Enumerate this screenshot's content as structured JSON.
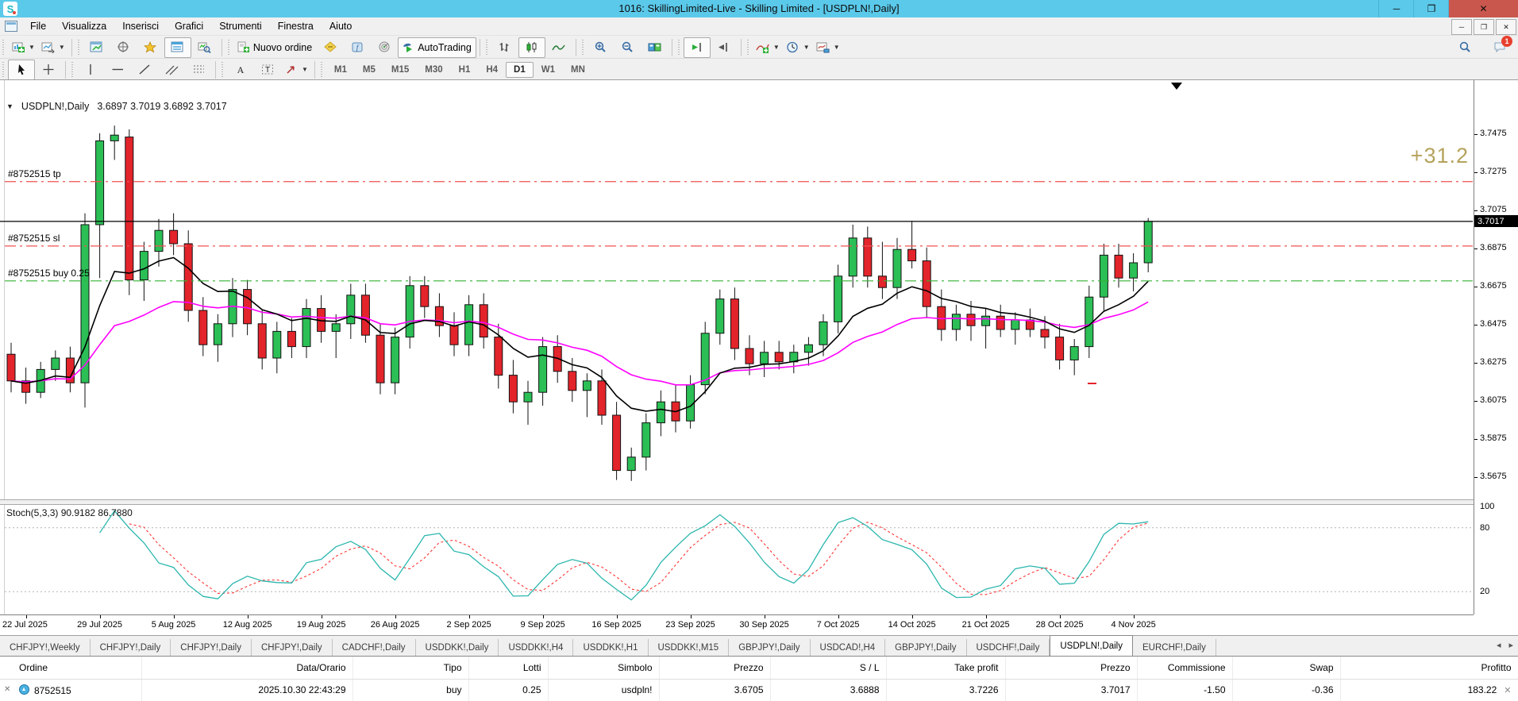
{
  "window": {
    "title": "1016: SkillingLimited-Live - Skilling Limited - [USDPLN!,Daily]",
    "controls": {
      "minimize": "─",
      "restore": "❐",
      "close": "✕"
    }
  },
  "menu": {
    "items": [
      "File",
      "Visualizza",
      "Inserisci",
      "Grafici",
      "Strumenti",
      "Finestra",
      "Aiuto"
    ]
  },
  "toolbar_main": {
    "groups": [
      [
        {
          "icon": "new-chart",
          "dd": true
        },
        {
          "icon": "profiles",
          "dd": true
        }
      ],
      [
        {
          "icon": "market-watch"
        },
        {
          "icon": "data-window"
        },
        {
          "icon": "navigator"
        },
        {
          "icon": "terminal",
          "sel": true
        },
        {
          "icon": "tester"
        }
      ],
      [
        {
          "icon": "new-order",
          "label": "Nuovo ordine"
        },
        {
          "icon": "metaeditor"
        },
        {
          "icon": "experts"
        },
        {
          "icon": "radar"
        },
        {
          "icon": "autotrading",
          "label": "AutoTrading",
          "sel": true
        }
      ],
      [
        {
          "icon": "bars"
        },
        {
          "icon": "candles",
          "sel": true
        },
        {
          "icon": "linechart"
        }
      ],
      [
        {
          "icon": "zoom-in"
        },
        {
          "icon": "zoom-out"
        },
        {
          "icon": "tiles"
        }
      ],
      [
        {
          "icon": "autoscroll",
          "sel": true
        },
        {
          "icon": "shift"
        }
      ],
      [
        {
          "icon": "indicators",
          "dd": true
        },
        {
          "icon": "periods",
          "dd": true
        },
        {
          "icon": "templates",
          "dd": true
        }
      ]
    ],
    "right": [
      {
        "icon": "search"
      },
      {
        "icon": "chat",
        "badge": "1"
      }
    ]
  },
  "toolbar_draw": {
    "groups": [
      [
        {
          "icon": "cursor",
          "sel": true
        },
        {
          "icon": "crosshair"
        }
      ],
      [
        {
          "icon": "vline"
        },
        {
          "icon": "hline"
        },
        {
          "icon": "trendline"
        },
        {
          "icon": "channel"
        },
        {
          "icon": "fibonacci"
        }
      ],
      [
        {
          "icon": "text"
        },
        {
          "icon": "label"
        },
        {
          "icon": "arrows",
          "dd": true
        }
      ]
    ]
  },
  "timeframes": {
    "items": [
      "M1",
      "M5",
      "M15",
      "M30",
      "H1",
      "H4",
      "D1",
      "W1",
      "MN"
    ],
    "active": "D1"
  },
  "chart": {
    "symbol_label": "USDPLN!,Daily",
    "ohlc_string": "3.6897 3.7019 3.6892 3.7017",
    "profit_label": "+31.2",
    "stoch_label": "Stoch(5,3,3) 90.9182 86.7880",
    "order_labels": {
      "tp": "#8752515 tp",
      "sl": "#8752515 sl",
      "buy": "#8752515 buy 0.25"
    }
  },
  "chart_data": {
    "type": "candlestick",
    "title": "USDPLN! Daily",
    "bid": 3.7017,
    "bid_display": "3.7017",
    "order": {
      "ticket": "#8752515",
      "take_profit": 3.7226,
      "stop_loss": 3.6888,
      "open_price": 3.6705,
      "lots": "0.25"
    },
    "price_axis_ticks": [
      "3.7475",
      "3.7275",
      "3.7075",
      "3.6875",
      "3.6675",
      "3.6475",
      "3.6275",
      "3.6075",
      "3.5875",
      "3.5675"
    ],
    "date_ticks": [
      "22 Jul 2025",
      "29 Jul 2025",
      "5 Aug 2025",
      "12 Aug 2025",
      "19 Aug 2025",
      "26 Aug 2025",
      "2 Sep 2025",
      "9 Sep 2025",
      "16 Sep 2025",
      "23 Sep 2025",
      "30 Sep 2025",
      "7 Oct 2025",
      "14 Oct 2025",
      "21 Oct 2025",
      "28 Oct 2025",
      "4 Nov 2025"
    ],
    "stochastic": {
      "label": "Stoch(5,3,3)",
      "k": "90.9182",
      "d": "86.7880",
      "levels": [
        80,
        20
      ],
      "scale_labels": [
        "100",
        "80",
        "20"
      ]
    },
    "ma_fast_period": 9,
    "ma_slow_period": 21,
    "candles": [
      [
        3.632,
        3.638,
        3.612,
        3.618
      ],
      [
        3.618,
        3.625,
        3.606,
        3.612
      ],
      [
        3.612,
        3.628,
        3.609,
        3.624
      ],
      [
        3.624,
        3.634,
        3.618,
        3.63
      ],
      [
        3.63,
        3.636,
        3.612,
        3.617
      ],
      [
        3.617,
        3.706,
        3.604,
        3.7
      ],
      [
        3.7,
        3.748,
        3.672,
        3.744
      ],
      [
        3.744,
        3.752,
        3.734,
        3.747
      ],
      [
        3.746,
        3.75,
        3.663,
        3.671
      ],
      [
        3.671,
        3.691,
        3.66,
        3.686
      ],
      [
        3.686,
        3.703,
        3.678,
        3.697
      ],
      [
        3.697,
        3.706,
        3.684,
        3.69
      ],
      [
        3.69,
        3.697,
        3.649,
        3.655
      ],
      [
        3.655,
        3.662,
        3.631,
        3.637
      ],
      [
        3.637,
        3.653,
        3.628,
        3.648
      ],
      [
        3.648,
        3.672,
        3.641,
        3.666
      ],
      [
        3.666,
        3.671,
        3.642,
        3.648
      ],
      [
        3.648,
        3.655,
        3.624,
        3.63
      ],
      [
        3.63,
        3.649,
        3.622,
        3.644
      ],
      [
        3.644,
        3.651,
        3.63,
        3.636
      ],
      [
        3.636,
        3.661,
        3.63,
        3.656
      ],
      [
        3.656,
        3.663,
        3.638,
        3.644
      ],
      [
        3.644,
        3.653,
        3.63,
        3.648
      ],
      [
        3.648,
        3.669,
        3.64,
        3.663
      ],
      [
        3.663,
        3.669,
        3.638,
        3.642
      ],
      [
        3.642,
        3.648,
        3.611,
        3.617
      ],
      [
        3.617,
        3.646,
        3.611,
        3.641
      ],
      [
        3.641,
        3.673,
        3.635,
        3.668
      ],
      [
        3.668,
        3.673,
        3.651,
        3.657
      ],
      [
        3.657,
        3.664,
        3.641,
        3.647
      ],
      [
        3.647,
        3.654,
        3.631,
        3.637
      ],
      [
        3.637,
        3.663,
        3.631,
        3.658
      ],
      [
        3.658,
        3.664,
        3.635,
        3.641
      ],
      [
        3.641,
        3.648,
        3.614,
        3.621
      ],
      [
        3.621,
        3.629,
        3.601,
        3.607
      ],
      [
        3.607,
        3.618,
        3.595,
        3.612
      ],
      [
        3.612,
        3.641,
        3.605,
        3.636
      ],
      [
        3.636,
        3.642,
        3.617,
        3.623
      ],
      [
        3.623,
        3.63,
        3.607,
        3.613
      ],
      [
        3.613,
        3.622,
        3.599,
        3.618
      ],
      [
        3.618,
        3.624,
        3.595,
        3.6
      ],
      [
        3.6,
        3.607,
        3.566,
        3.571
      ],
      [
        3.571,
        3.583,
        3.5655,
        3.578
      ],
      [
        3.578,
        3.601,
        3.571,
        3.596
      ],
      [
        3.596,
        3.613,
        3.589,
        3.607
      ],
      [
        3.607,
        3.616,
        3.591,
        3.597
      ],
      [
        3.597,
        3.621,
        3.593,
        3.616
      ],
      [
        3.616,
        3.649,
        3.611,
        3.643
      ],
      [
        3.643,
        3.666,
        3.637,
        3.661
      ],
      [
        3.661,
        3.667,
        3.629,
        3.635
      ],
      [
        3.635,
        3.642,
        3.621,
        3.627
      ],
      [
        3.627,
        3.639,
        3.62,
        3.633
      ],
      [
        3.633,
        3.639,
        3.624,
        3.628
      ],
      [
        3.628,
        3.637,
        3.622,
        3.633
      ],
      [
        3.633,
        3.641,
        3.626,
        3.637
      ],
      [
        3.637,
        3.653,
        3.631,
        3.649
      ],
      [
        3.649,
        3.679,
        3.643,
        3.673
      ],
      [
        3.673,
        3.7,
        3.667,
        3.693
      ],
      [
        3.693,
        3.699,
        3.667,
        3.673
      ],
      [
        3.673,
        3.691,
        3.661,
        3.667
      ],
      [
        3.667,
        3.693,
        3.661,
        3.687
      ],
      [
        3.687,
        3.702,
        3.677,
        3.681
      ],
      [
        3.681,
        3.688,
        3.651,
        3.657
      ],
      [
        3.657,
        3.666,
        3.639,
        3.645
      ],
      [
        3.645,
        3.658,
        3.639,
        3.653
      ],
      [
        3.653,
        3.66,
        3.639,
        3.647
      ],
      [
        3.647,
        3.656,
        3.635,
        3.652
      ],
      [
        3.652,
        3.658,
        3.641,
        3.645
      ],
      [
        3.645,
        3.654,
        3.637,
        3.65
      ],
      [
        3.65,
        3.656,
        3.641,
        3.645
      ],
      [
        3.645,
        3.652,
        3.635,
        3.641
      ],
      [
        3.641,
        3.648,
        3.624,
        3.629
      ],
      [
        3.629,
        3.64,
        3.621,
        3.636
      ],
      [
        3.636,
        3.668,
        3.63,
        3.662
      ],
      [
        3.662,
        3.69,
        3.655,
        3.684
      ],
      [
        3.684,
        3.69,
        3.667,
        3.672
      ],
      [
        3.672,
        3.685,
        3.665,
        3.68
      ],
      [
        3.68,
        3.7035,
        3.675,
        3.7017
      ]
    ]
  },
  "colors": {
    "candle_up": "#2bbf56",
    "candle_down": "#e3242b",
    "ma_fast": "#000000",
    "ma_slow": "#ff00ff",
    "stoch_main": "#2ab6ad",
    "stoch_signal": "#ff3333",
    "tp_sl_line": "#f05050",
    "buy_line": "#33b333",
    "profit_text": "#b5a35c",
    "titlebar": "#5bc9ea"
  },
  "tabs": {
    "items": [
      "CHFJPY!,Weekly",
      "CHFJPY!,Daily",
      "CHFJPY!,Daily",
      "CHFJPY!,Daily",
      "CADCHF!,Daily",
      "USDDKK!,Daily",
      "USDDKK!,H4",
      "USDDKK!,H1",
      "USDDKK!,M15",
      "GBPJPY!,Daily",
      "USDCAD!,H4",
      "GBPJPY!,Daily",
      "USDCHF!,Daily",
      "USDPLN!,Daily",
      "EURCHF!,Daily"
    ],
    "active_index": 13
  },
  "terminal": {
    "headers": [
      "Ordine",
      "Data/Orario",
      "Tipo",
      "Lotti",
      "Simbolo",
      "Prezzo",
      "S / L",
      "Take profit",
      "Prezzo",
      "Commissione",
      "Swap",
      "Profitto"
    ],
    "rows": [
      [
        "8752515",
        "2025.10.30 22:43:29",
        "buy",
        "0.25",
        "usdpln!",
        "3.6705",
        "3.6888",
        "3.7226",
        "3.7017",
        "-1.50",
        "-0.36",
        "183.22"
      ]
    ]
  }
}
